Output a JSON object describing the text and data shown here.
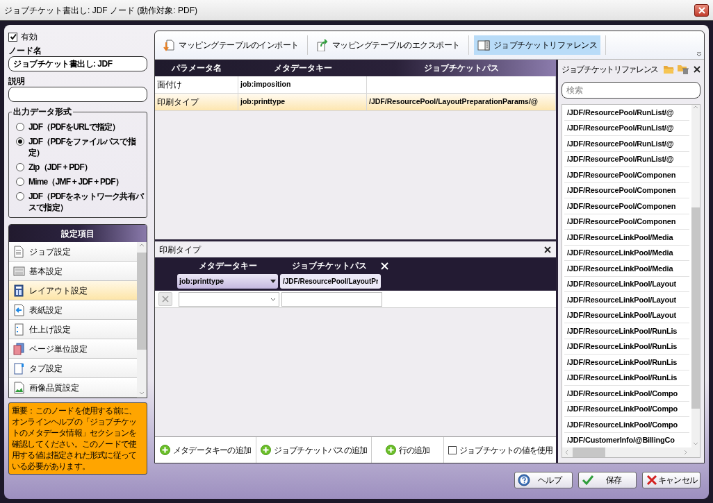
{
  "window": {
    "title": "ジョブチケット書出し: JDF ノード (動作対象: PDF)"
  },
  "enabled": {
    "label": "有効",
    "checked": true
  },
  "node_name": {
    "label": "ノード名",
    "value": "ジョブチケット書出し: JDF"
  },
  "description": {
    "label": "説明"
  },
  "output_format": {
    "label": "出力データ形式",
    "options": [
      {
        "label": "JDF（PDFをURLで指定）",
        "selected": false
      },
      {
        "label": "JDF（PDFをファイルパスで指定）",
        "selected": true
      },
      {
        "label": "Zip（JDF + PDF）",
        "selected": false
      },
      {
        "label": "Mime（JMF + JDF + PDF）",
        "selected": false
      },
      {
        "label": "JDF（PDFをネットワーク共有パスで指定）",
        "selected": false
      }
    ]
  },
  "settings": {
    "title": "設定項目",
    "items": [
      {
        "label": "ジョブ設定",
        "selected": false
      },
      {
        "label": "基本設定",
        "selected": false
      },
      {
        "label": "レイアウト設定",
        "selected": true
      },
      {
        "label": "表紙設定",
        "selected": false
      },
      {
        "label": "仕上げ設定",
        "selected": false
      },
      {
        "label": "ページ単位設定",
        "selected": false
      },
      {
        "label": "タブ設定",
        "selected": false
      },
      {
        "label": "画像品質設定",
        "selected": false
      }
    ]
  },
  "notice": "重要：このノードを使用する前に、オンラインヘルプの「ジョブチケットのメタデータ情報」セクションを確認してください。このノードで使用する値は指定された形式に従っている必要があります。",
  "toolbar": [
    {
      "label": "マッピングテーブルのインポート",
      "selected": false
    },
    {
      "label": "マッピングテーブルのエクスポート",
      "selected": false
    },
    {
      "label": "ジョブチケットリファレンス",
      "selected": true
    }
  ],
  "mapping_table": {
    "columns": [
      "パラメータ名",
      "メタデータキー",
      "ジョブチケットパス"
    ],
    "rows": [
      {
        "cells": [
          "面付け",
          "job:imposition"
        ],
        "selected": false
      },
      {
        "cells": [
          "印刷タイプ",
          "job:printtype",
          "/JDF/ResourcePool/LayoutPreparationParams/@"
        ],
        "selected": true
      }
    ]
  },
  "detail": {
    "title": "印刷タイプ",
    "columns": [
      "メタデータキー",
      "ジョブチケットパス"
    ],
    "key": "job:printtype",
    "path": "/JDF/ResourcePool/LayoutPr"
  },
  "actions": [
    "メタデータキーの追加",
    "ジョブチケットパスの追加",
    "行の追加"
  ],
  "use_ticket_value": {
    "label": "ジョブチケットの値を使用",
    "checked": false
  },
  "reference": {
    "title": "ジョブチケットリファレンス",
    "search_placeholder": "検索",
    "items": [
      "/JDF/ResourcePool/RunList/@",
      "/JDF/ResourcePool/RunList/@",
      "/JDF/ResourcePool/RunList/@",
      "/JDF/ResourcePool/RunList/@",
      "/JDF/ResourcePool/Componen",
      "/JDF/ResourcePool/Componen",
      "/JDF/ResourcePool/Componen",
      "/JDF/ResourcePool/Componen",
      "/JDF/ResourceLinkPool/Media",
      "/JDF/ResourceLinkPool/Media",
      "/JDF/ResourceLinkPool/Media",
      "/JDF/ResourceLinkPool/Layout",
      "/JDF/ResourceLinkPool/Layout",
      "/JDF/ResourceLinkPool/Layout",
      "/JDF/ResourceLinkPool/RunLis",
      "/JDF/ResourceLinkPool/RunLis",
      "/JDF/ResourceLinkPool/RunLis",
      "/JDF/ResourceLinkPool/RunLis",
      "/JDF/ResourceLinkPool/Compo",
      "/JDF/ResourceLinkPool/Compo",
      "/JDF/ResourceLinkPool/Compo",
      "/JDF/CustomerInfo/@BillingCo"
    ]
  },
  "buttons": [
    {
      "label": "ヘルプ",
      "kind": "help"
    },
    {
      "label": "保存",
      "kind": "save"
    },
    {
      "label": "キャンセル",
      "kind": "cancel"
    }
  ]
}
